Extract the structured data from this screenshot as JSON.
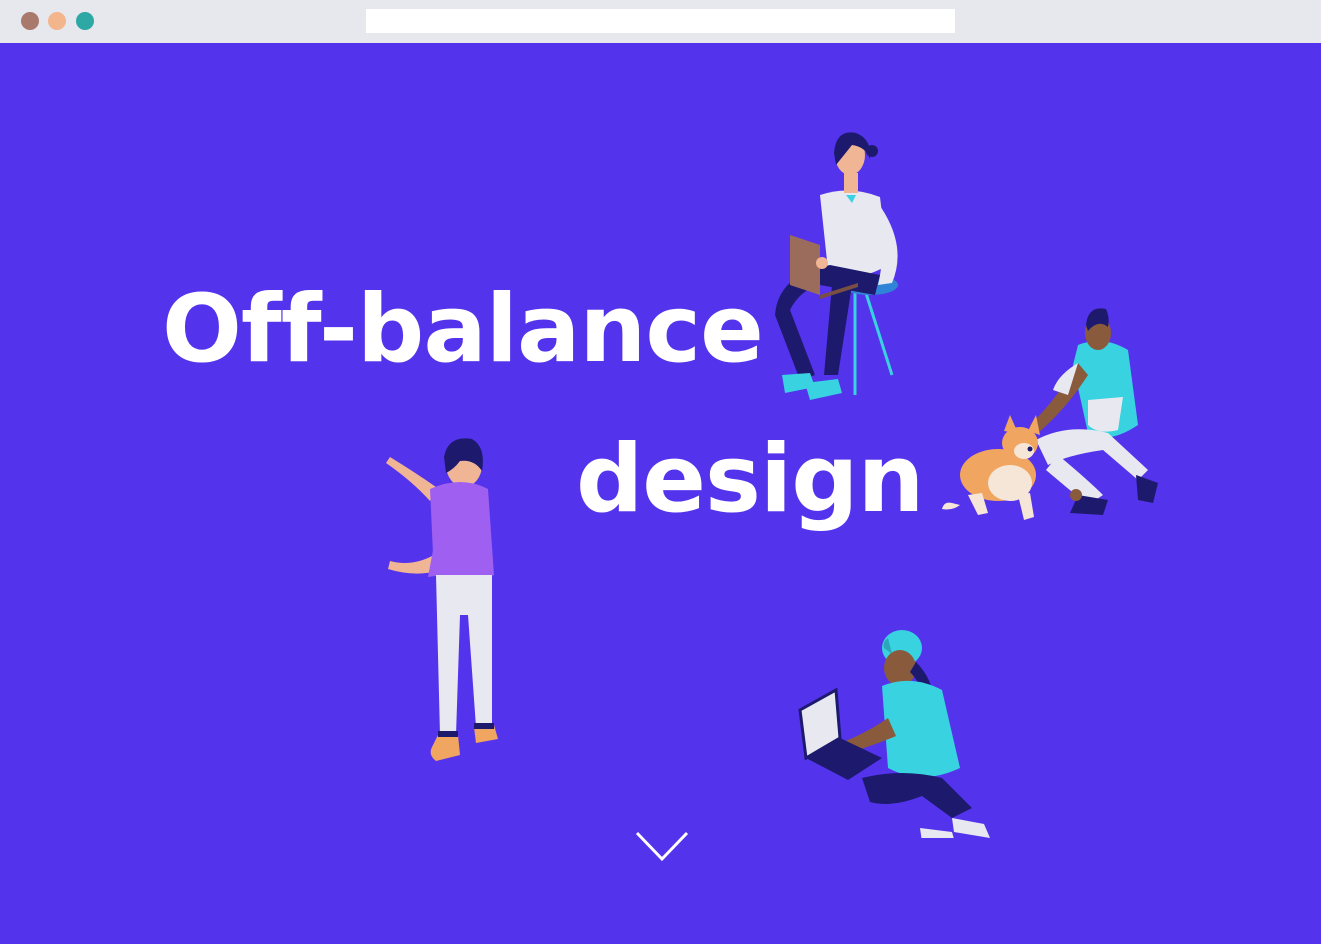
{
  "browser": {
    "address": ""
  },
  "hero": {
    "headline_line1": "Off-balance",
    "headline_line2": "design",
    "background_color": "#5433ec"
  },
  "illustrations": [
    {
      "name": "woman-with-laptop-on-stool",
      "icon": "person-laptop-illustration"
    },
    {
      "name": "man-with-corgi",
      "icon": "person-dog-illustration"
    },
    {
      "name": "man-pointing",
      "icon": "person-pointing-illustration"
    },
    {
      "name": "person-with-laptop-on-floor",
      "icon": "person-laptop-floor-illustration"
    }
  ],
  "scroll": {
    "icon": "chevron-down-icon"
  }
}
